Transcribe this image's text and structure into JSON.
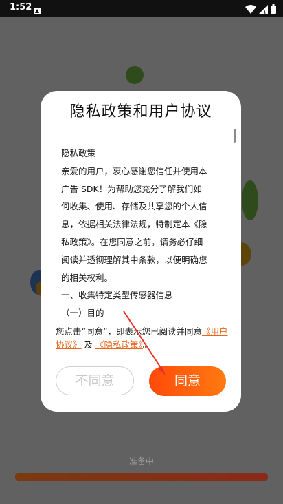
{
  "status_bar": {
    "time": "1:52"
  },
  "dialog": {
    "title": "隐私政策和用户协议",
    "policy_lines": [
      "隐私政策",
      "亲爱的用户，衷心感谢您信任并使用本",
      "广告 SDK！为帮助您充分了解我们如",
      "何收集、使用、存储及共享您的个人信",
      "息，依据相关法律法规，特制定本《隐",
      "私政策》。在您同意之前，请务必仔细",
      "阅读并透彻理解其中条款，以便明确您",
      "的相关权利。",
      "一、收集特定类型传感器信息",
      "（一）目的"
    ],
    "consent": {
      "prefix": "您点击“同意”，即表示您已阅读并同意",
      "user_agreement_link": "《用户协议》",
      "and": "及",
      "privacy_policy_link": "《隐私政策》",
      "suffix": "。"
    },
    "disagree_label": "不同意",
    "agree_label": "同意"
  },
  "background": {
    "loading_text": "准备中",
    "progress": 1.0
  },
  "colors": {
    "accent": "#ff5a0e",
    "link": "#e8651a"
  }
}
